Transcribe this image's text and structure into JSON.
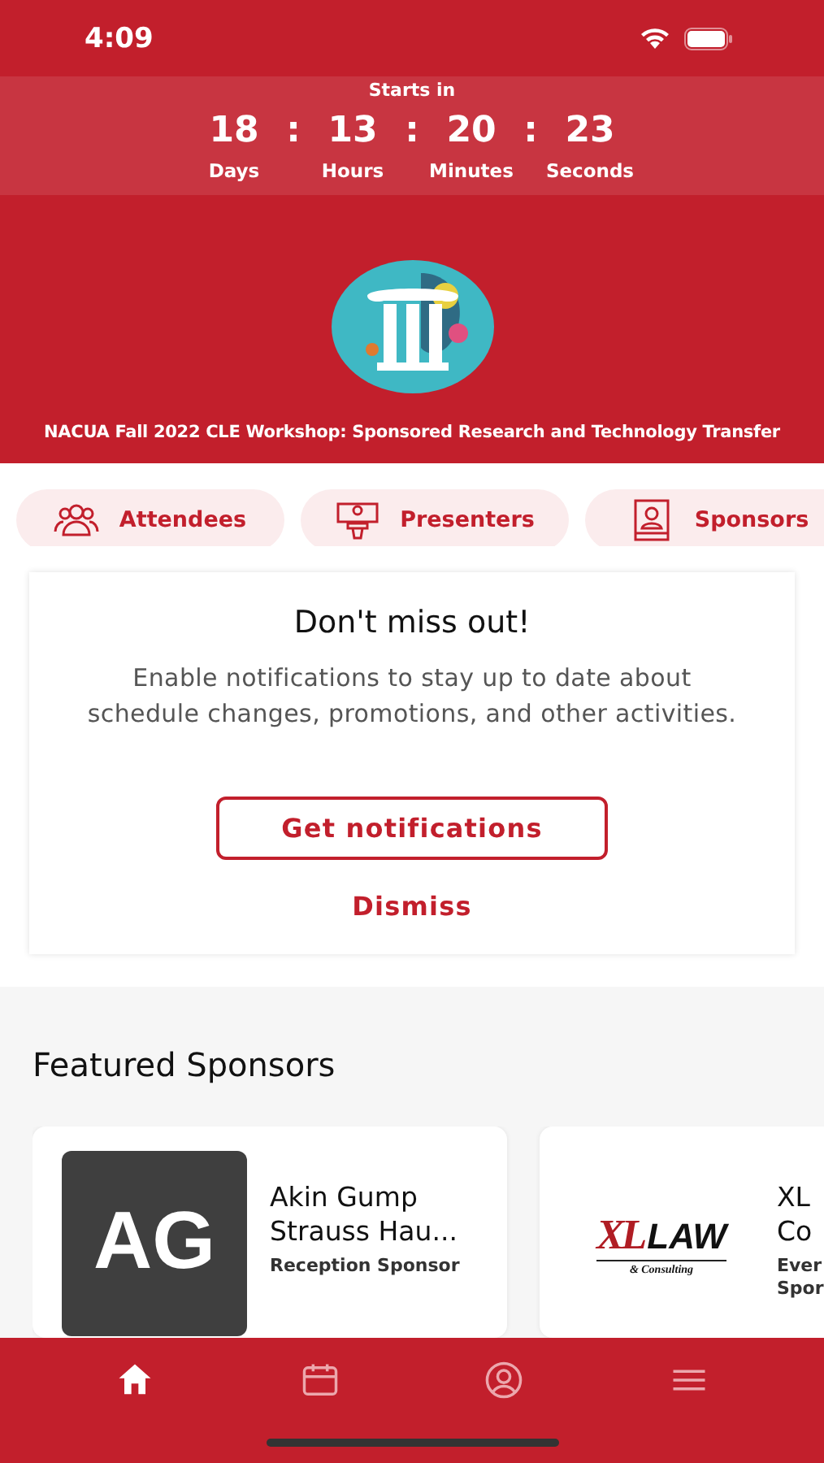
{
  "status_bar": {
    "time": "4:09"
  },
  "countdown": {
    "label": "Starts in",
    "units": [
      {
        "value": "18",
        "unit": "Days"
      },
      {
        "value": "13",
        "unit": "Hours"
      },
      {
        "value": "20",
        "unit": "Minutes"
      },
      {
        "value": "23",
        "unit": "Seconds"
      }
    ],
    "separator": ":"
  },
  "event": {
    "title": "NACUA Fall 2022 CLE Workshop: Sponsored Research and Technology Transfer"
  },
  "quick_links": [
    {
      "label": "Attendees"
    },
    {
      "label": "Presenters"
    },
    {
      "label": "Sponsors"
    }
  ],
  "notice": {
    "title": "Don't miss out!",
    "text": "Enable notifications to stay up to date about schedule changes, promotions, and other activities.",
    "primary": "Get notifications",
    "secondary": "Dismiss"
  },
  "featured": {
    "heading": "Featured Sponsors",
    "sponsors": [
      {
        "kind": "monogram",
        "logo_text": [
          "AG"
        ],
        "name": [
          "Akin Gump",
          "Strauss Hau..."
        ],
        "role": [
          "Reception Sponsor"
        ]
      },
      {
        "kind": "wordmark",
        "logo_text": [
          "XL",
          "LAW",
          "& Consulting"
        ],
        "name": [
          "XL",
          "Co"
        ],
        "role": [
          "Ever",
          "Spor"
        ]
      }
    ]
  },
  "tab_bar": [
    {
      "selected": true
    },
    {
      "selected": false
    },
    {
      "selected": false
    },
    {
      "selected": false
    }
  ]
}
